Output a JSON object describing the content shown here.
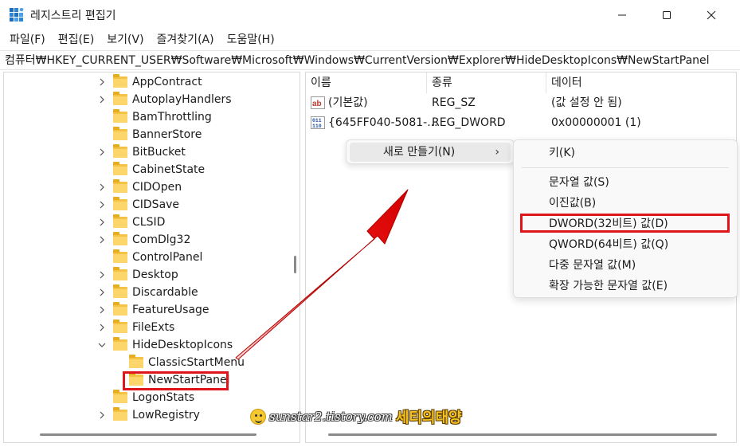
{
  "window": {
    "title": "레지스트리 편집기",
    "icons": {
      "app": "regedit-icon",
      "minimize": "minimize-icon",
      "maximize": "maximize-icon",
      "close": "close-icon"
    }
  },
  "menubar": {
    "items": [
      "파일(F)",
      "편집(E)",
      "보기(V)",
      "즐겨찾기(A)",
      "도움말(H)"
    ]
  },
  "address": {
    "path": "컴퓨터₩HKEY_CURRENT_USER₩Software₩Microsoft₩Windows₩CurrentVersion₩Explorer₩HideDesktopIcons₩NewStartPanel"
  },
  "tree": {
    "items": [
      {
        "label": "AppContract",
        "expander": "collapsed",
        "depth": 1
      },
      {
        "label": "AutoplayHandlers",
        "expander": "collapsed",
        "depth": 1
      },
      {
        "label": "BamThrottling",
        "expander": "none",
        "depth": 1
      },
      {
        "label": "BannerStore",
        "expander": "none",
        "depth": 1
      },
      {
        "label": "BitBucket",
        "expander": "collapsed",
        "depth": 1
      },
      {
        "label": "CabinetState",
        "expander": "none",
        "depth": 1
      },
      {
        "label": "CIDOpen",
        "expander": "collapsed",
        "depth": 1
      },
      {
        "label": "CIDSave",
        "expander": "collapsed",
        "depth": 1
      },
      {
        "label": "CLSID",
        "expander": "collapsed",
        "depth": 1
      },
      {
        "label": "ComDlg32",
        "expander": "collapsed",
        "depth": 1
      },
      {
        "label": "ControlPanel",
        "expander": "none",
        "depth": 1
      },
      {
        "label": "Desktop",
        "expander": "collapsed",
        "depth": 1
      },
      {
        "label": "Discardable",
        "expander": "collapsed",
        "depth": 1
      },
      {
        "label": "FeatureUsage",
        "expander": "collapsed",
        "depth": 1
      },
      {
        "label": "FileExts",
        "expander": "collapsed",
        "depth": 1
      },
      {
        "label": "HideDesktopIcons",
        "expander": "expanded",
        "depth": 1
      },
      {
        "label": "ClassicStartMenu",
        "expander": "none",
        "depth": 2
      },
      {
        "label": "NewStartPanel",
        "expander": "none",
        "depth": 2,
        "selected": true
      },
      {
        "label": "LogonStats",
        "expander": "none",
        "depth": 1
      },
      {
        "label": "LowRegistry",
        "expander": "collapsed",
        "depth": 1
      }
    ]
  },
  "list": {
    "columns": [
      "이름",
      "종류",
      "데이터"
    ],
    "rows": [
      {
        "name": "(기본값)",
        "type": "REG_SZ",
        "data": "(값 설정 안 됨)",
        "icon": "string-value-icon"
      },
      {
        "name": "{645FF040-5081-...",
        "type": "REG_DWORD",
        "data": "0x00000001 (1)",
        "icon": "binary-value-icon"
      }
    ]
  },
  "context_menu": {
    "item": "새로 만들기(N)",
    "arrow": "›"
  },
  "sub_menu": {
    "key_item": "키(K)",
    "items": [
      "문자열 값(S)",
      "이진값(B)",
      "DWORD(32비트) 값(D)",
      "QWORD(64비트) 값(Q)",
      "다중 문자열 값(M)",
      "확장 가능한 문자열 값(E)"
    ],
    "highlighted": "DWORD(32비트) 값(D)"
  },
  "watermark": {
    "url": "sunstar2.tistory.com",
    "name": "세티의태양"
  },
  "colors": {
    "highlight_red": "#e0141b",
    "folder_yellow": "#f5c343"
  }
}
